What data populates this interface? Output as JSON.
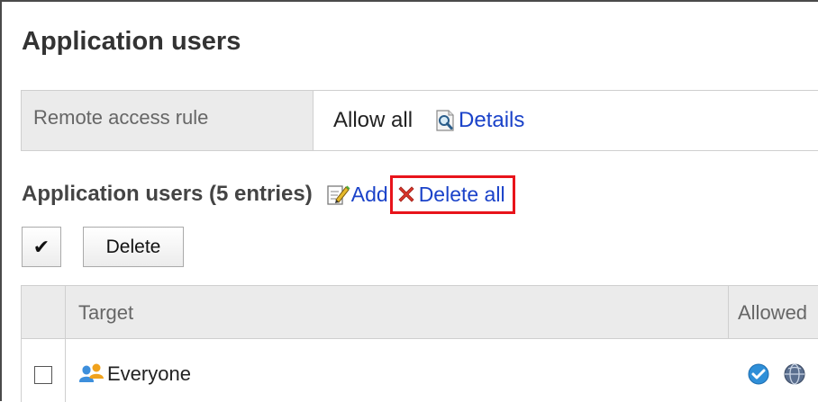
{
  "page": {
    "title": "Application users"
  },
  "remote_access": {
    "label": "Remote access rule",
    "value": "Allow all",
    "details_link": "Details",
    "details_icon": "magnifier-page-icon"
  },
  "section": {
    "title": "Application users (5 entries)",
    "add_link": "Add",
    "add_icon": "pencil-edit-icon",
    "delete_all_link": "Delete all",
    "delete_all_icon": "red-x-icon",
    "highlight_color": "#e8141b"
  },
  "toolbar": {
    "check_all_label": "✔",
    "delete_label": "Delete"
  },
  "table": {
    "columns": [
      "Target",
      "Allowed"
    ],
    "rows": [
      {
        "target": "Everyone",
        "target_icon": "group-users-icon",
        "allowed_icons": [
          "app-check-icon",
          "globe-icon"
        ]
      }
    ]
  },
  "colors": {
    "link": "#1a42c9",
    "header_bg": "#ebebeb"
  }
}
